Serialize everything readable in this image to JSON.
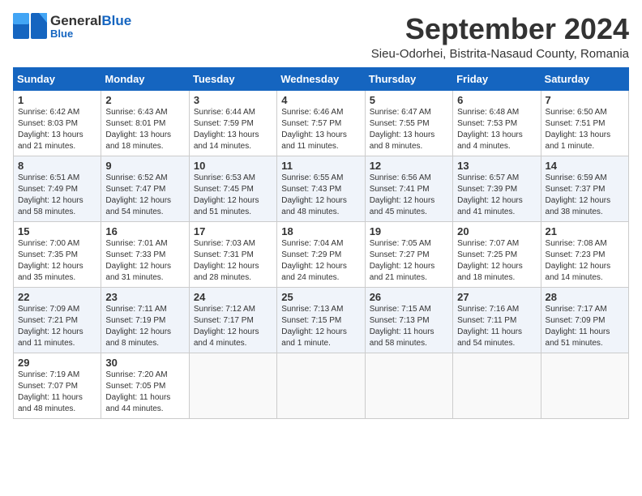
{
  "header": {
    "logo_general": "General",
    "logo_blue": "Blue",
    "main_title": "September 2024",
    "subtitle": "Sieu-Odorhei, Bistrita-Nasaud County, Romania"
  },
  "weekdays": [
    "Sunday",
    "Monday",
    "Tuesday",
    "Wednesday",
    "Thursday",
    "Friday",
    "Saturday"
  ],
  "weeks": [
    [
      {
        "day": 1,
        "sunrise": "6:42 AM",
        "sunset": "8:03 PM",
        "daylight": "13 hours and 21 minutes."
      },
      {
        "day": 2,
        "sunrise": "6:43 AM",
        "sunset": "8:01 PM",
        "daylight": "13 hours and 18 minutes."
      },
      {
        "day": 3,
        "sunrise": "6:44 AM",
        "sunset": "7:59 PM",
        "daylight": "13 hours and 14 minutes."
      },
      {
        "day": 4,
        "sunrise": "6:46 AM",
        "sunset": "7:57 PM",
        "daylight": "13 hours and 11 minutes."
      },
      {
        "day": 5,
        "sunrise": "6:47 AM",
        "sunset": "7:55 PM",
        "daylight": "13 hours and 8 minutes."
      },
      {
        "day": 6,
        "sunrise": "6:48 AM",
        "sunset": "7:53 PM",
        "daylight": "13 hours and 4 minutes."
      },
      {
        "day": 7,
        "sunrise": "6:50 AM",
        "sunset": "7:51 PM",
        "daylight": "13 hours and 1 minute."
      }
    ],
    [
      {
        "day": 8,
        "sunrise": "6:51 AM",
        "sunset": "7:49 PM",
        "daylight": "12 hours and 58 minutes."
      },
      {
        "day": 9,
        "sunrise": "6:52 AM",
        "sunset": "7:47 PM",
        "daylight": "12 hours and 54 minutes."
      },
      {
        "day": 10,
        "sunrise": "6:53 AM",
        "sunset": "7:45 PM",
        "daylight": "12 hours and 51 minutes."
      },
      {
        "day": 11,
        "sunrise": "6:55 AM",
        "sunset": "7:43 PM",
        "daylight": "12 hours and 48 minutes."
      },
      {
        "day": 12,
        "sunrise": "6:56 AM",
        "sunset": "7:41 PM",
        "daylight": "12 hours and 45 minutes."
      },
      {
        "day": 13,
        "sunrise": "6:57 AM",
        "sunset": "7:39 PM",
        "daylight": "12 hours and 41 minutes."
      },
      {
        "day": 14,
        "sunrise": "6:59 AM",
        "sunset": "7:37 PM",
        "daylight": "12 hours and 38 minutes."
      }
    ],
    [
      {
        "day": 15,
        "sunrise": "7:00 AM",
        "sunset": "7:35 PM",
        "daylight": "12 hours and 35 minutes."
      },
      {
        "day": 16,
        "sunrise": "7:01 AM",
        "sunset": "7:33 PM",
        "daylight": "12 hours and 31 minutes."
      },
      {
        "day": 17,
        "sunrise": "7:03 AM",
        "sunset": "7:31 PM",
        "daylight": "12 hours and 28 minutes."
      },
      {
        "day": 18,
        "sunrise": "7:04 AM",
        "sunset": "7:29 PM",
        "daylight": "12 hours and 24 minutes."
      },
      {
        "day": 19,
        "sunrise": "7:05 AM",
        "sunset": "7:27 PM",
        "daylight": "12 hours and 21 minutes."
      },
      {
        "day": 20,
        "sunrise": "7:07 AM",
        "sunset": "7:25 PM",
        "daylight": "12 hours and 18 minutes."
      },
      {
        "day": 21,
        "sunrise": "7:08 AM",
        "sunset": "7:23 PM",
        "daylight": "12 hours and 14 minutes."
      }
    ],
    [
      {
        "day": 22,
        "sunrise": "7:09 AM",
        "sunset": "7:21 PM",
        "daylight": "12 hours and 11 minutes."
      },
      {
        "day": 23,
        "sunrise": "7:11 AM",
        "sunset": "7:19 PM",
        "daylight": "12 hours and 8 minutes."
      },
      {
        "day": 24,
        "sunrise": "7:12 AM",
        "sunset": "7:17 PM",
        "daylight": "12 hours and 4 minutes."
      },
      {
        "day": 25,
        "sunrise": "7:13 AM",
        "sunset": "7:15 PM",
        "daylight": "12 hours and 1 minute."
      },
      {
        "day": 26,
        "sunrise": "7:15 AM",
        "sunset": "7:13 PM",
        "daylight": "11 hours and 58 minutes."
      },
      {
        "day": 27,
        "sunrise": "7:16 AM",
        "sunset": "7:11 PM",
        "daylight": "11 hours and 54 minutes."
      },
      {
        "day": 28,
        "sunrise": "7:17 AM",
        "sunset": "7:09 PM",
        "daylight": "11 hours and 51 minutes."
      }
    ],
    [
      {
        "day": 29,
        "sunrise": "7:19 AM",
        "sunset": "7:07 PM",
        "daylight": "11 hours and 48 minutes."
      },
      {
        "day": 30,
        "sunrise": "7:20 AM",
        "sunset": "7:05 PM",
        "daylight": "11 hours and 44 minutes."
      },
      null,
      null,
      null,
      null,
      null
    ]
  ]
}
